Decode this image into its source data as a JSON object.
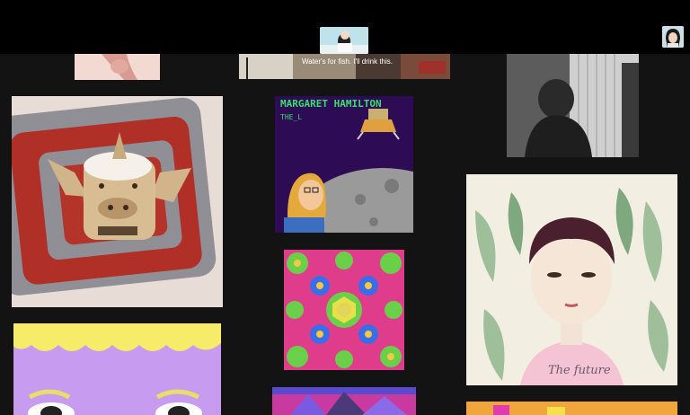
{
  "header": {
    "center_thumb_icon": "image-thumb",
    "avatar_icon": "user-avatar"
  },
  "tiles": {
    "movie_caption": "Water's for fish. I'll drink this.",
    "hamilton_title": "MARGARET HAMILTON",
    "hamilton_sub": "THE_L",
    "future_text": "The future"
  },
  "colors": {
    "background": "#131313",
    "topbar": "#000000",
    "pixel_green": "#38e06b"
  }
}
